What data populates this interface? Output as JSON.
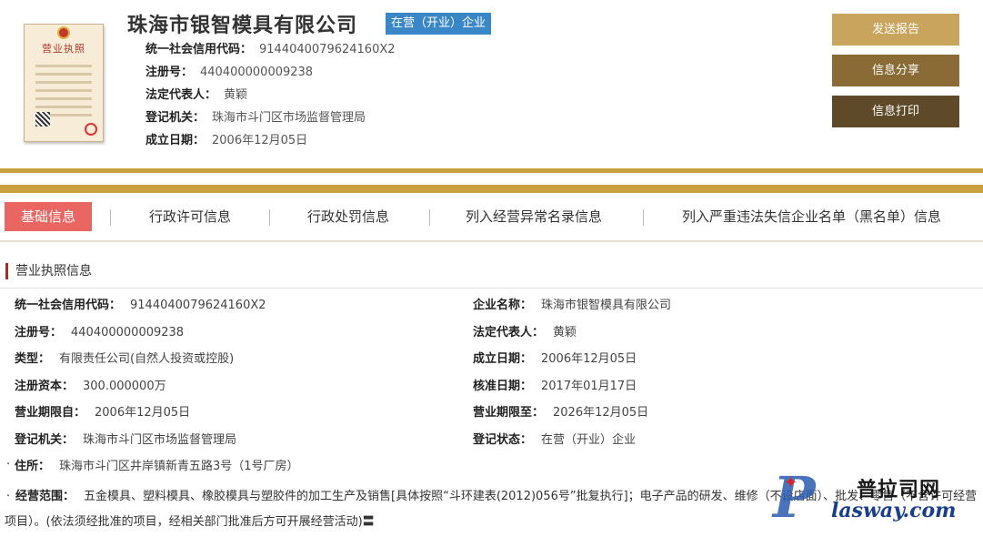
{
  "header": {
    "company_name": "珠海市银智模具有限公司",
    "status_tag": "在营（开业）企业",
    "license_image_title": "营业执照",
    "info": [
      {
        "label": "统一社会信用代码：",
        "value": "9144040079624160X2"
      },
      {
        "label": "注册号：",
        "value": "440400000009238"
      },
      {
        "label": "法定代表人：",
        "value": "黄颖"
      },
      {
        "label": "登记机关：",
        "value": "珠海市斗门区市场监督管理局"
      },
      {
        "label": "成立日期：",
        "value": "2006年12月05日"
      }
    ]
  },
  "buttons": {
    "send": "发送报告",
    "share": "信息分享",
    "print": "信息打印"
  },
  "tabs": [
    {
      "label": "基础信息",
      "active": true
    },
    {
      "label": "行政许可信息",
      "active": false
    },
    {
      "label": "行政处罚信息",
      "active": false
    },
    {
      "label": "列入经营异常名录信息",
      "active": false
    },
    {
      "label": "列入严重违法失信企业名单（黑名单）信息",
      "active": false
    }
  ],
  "section": {
    "title": "营业执照信息",
    "left_fields": [
      {
        "label": "统一社会信用代码：",
        "value": "9144040079624160X2"
      },
      {
        "label": "注册号：",
        "value": "440400000009238"
      },
      {
        "label": "类型：",
        "value": "有限责任公司(自然人投资或控股)"
      },
      {
        "label": "注册资本：",
        "value": "300.000000万"
      },
      {
        "label": "营业期限自：",
        "value": "2006年12月05日"
      },
      {
        "label": "登记机关：",
        "value": "珠海市斗门区市场监督管理局"
      }
    ],
    "right_fields": [
      {
        "label": "企业名称：",
        "value": "珠海市银智模具有限公司"
      },
      {
        "label": "法定代表人：",
        "value": "黄颖"
      },
      {
        "label": "成立日期：",
        "value": "2006年12月05日"
      },
      {
        "label": "核准日期：",
        "value": "2017年01月17日"
      },
      {
        "label": "营业期限至：",
        "value": "2026年12月05日"
      },
      {
        "label": "登记状态：",
        "value": "在营（开业）企业"
      }
    ],
    "address": {
      "label": "住所：",
      "value": "珠海市斗门区井岸镇新青五路3号（1号厂房）"
    },
    "scope": {
      "label": "经营范围：",
      "value": "五金模具、塑料模具、橡胶模具与塑胶件的加工生产及销售[具体按照“斗环建表(2012)056号”批复执行]；电子产品的研发、维修（不设店面）、批发、零售（不含许可经营项目）。(依法须经批准的项目，经相关部门批准后方可开展经营活动)〓"
    }
  },
  "watermark": {
    "letter": "P",
    "cn": "普拉司网",
    "url": "lasway.com"
  }
}
